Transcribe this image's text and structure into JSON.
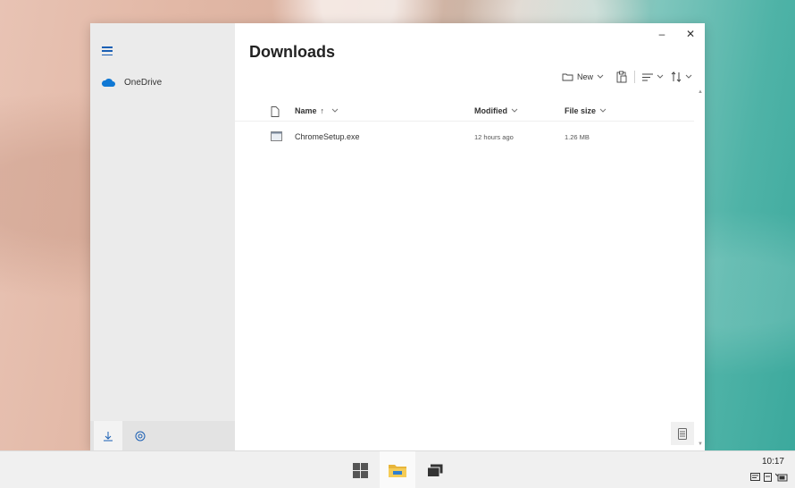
{
  "window": {
    "title": "Downloads",
    "minimize_glyph": "–",
    "close_glyph": "✕"
  },
  "sidebar": {
    "items": [
      {
        "label": "OneDrive",
        "icon": "cloud-icon"
      }
    ],
    "bottom_buttons": [
      {
        "icon": "download-icon",
        "active": true
      },
      {
        "icon": "settings-icon",
        "active": false
      }
    ]
  },
  "toolbar": {
    "new_label": "New",
    "chevron": "⌵"
  },
  "table": {
    "columns": [
      {
        "label": "Name",
        "sort": "↑"
      },
      {
        "label": "Modified"
      },
      {
        "label": "File size"
      }
    ],
    "rows": [
      {
        "name": "ChromeSetup.exe",
        "modified": "12 hours ago",
        "size": "1.26 MB"
      }
    ]
  },
  "taskbar": {
    "apps": [
      "windows-start-icon",
      "file-explorer-icon",
      "task-view-icon"
    ],
    "clock": "10:17"
  },
  "colors": {
    "accent": "#1a5fb4",
    "onedrive": "#0f78d4"
  }
}
